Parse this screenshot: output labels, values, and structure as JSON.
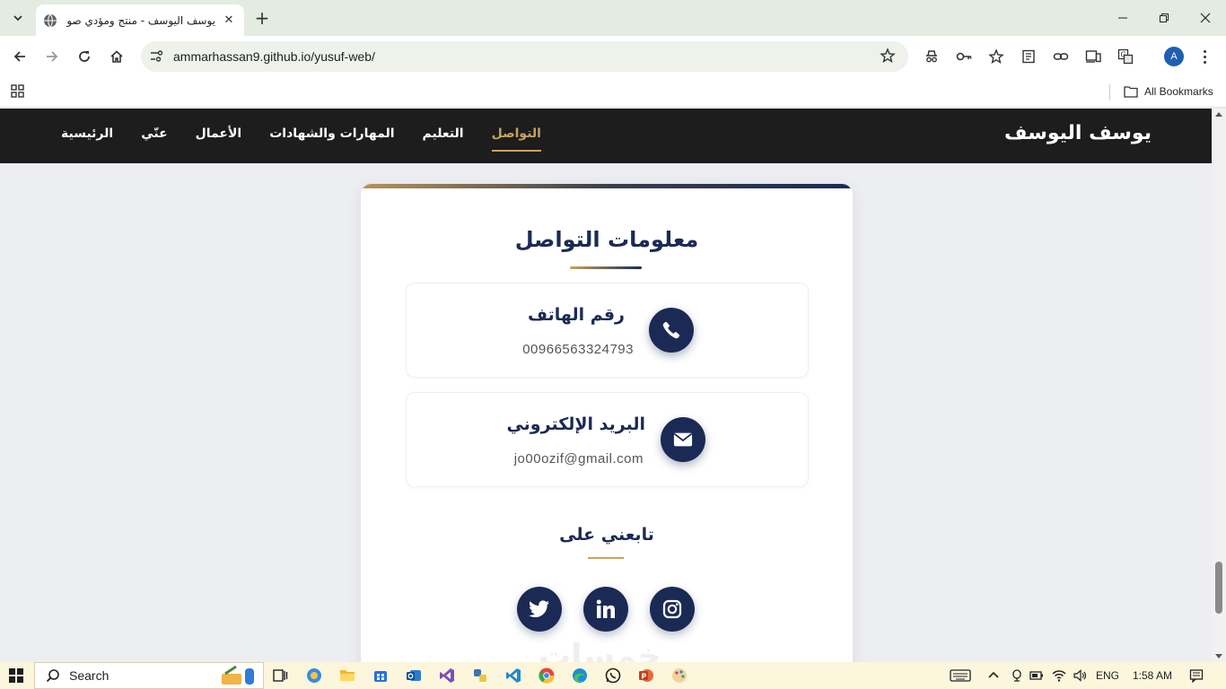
{
  "browser": {
    "tab_title": "يوسف اليوسف - منتج ومؤدي صو",
    "url": "ammarhassan9.github.io/yusuf-web/",
    "bookmarks_label": "All Bookmarks",
    "profile_initial": "A"
  },
  "site": {
    "brand": "يوسف اليوسف",
    "nav": [
      {
        "label": "الرئيسية"
      },
      {
        "label": "عنّي"
      },
      {
        "label": "الأعمال"
      },
      {
        "label": "المهارات والشهادات"
      },
      {
        "label": "التعليم"
      },
      {
        "label": "التواصل"
      }
    ],
    "active_nav": "التواصل"
  },
  "contact": {
    "title": "معلومات التواصل",
    "phone": {
      "label": "رقم الهاتف",
      "value": "00966563324793"
    },
    "email": {
      "label": "البريد الإلكتروني",
      "value": "jo00ozif@gmail.com"
    },
    "follow_title": "تابعني على",
    "social": [
      "twitter-icon",
      "linkedin-icon",
      "instagram-icon"
    ],
    "watermark": "خمسات"
  },
  "colors": {
    "navy": "#1b2a55",
    "gold": "#c9a25f",
    "nav_bg": "#1d1d1d"
  },
  "taskbar": {
    "search_label": "Search",
    "language": "ENG",
    "time": "1:58 AM"
  }
}
